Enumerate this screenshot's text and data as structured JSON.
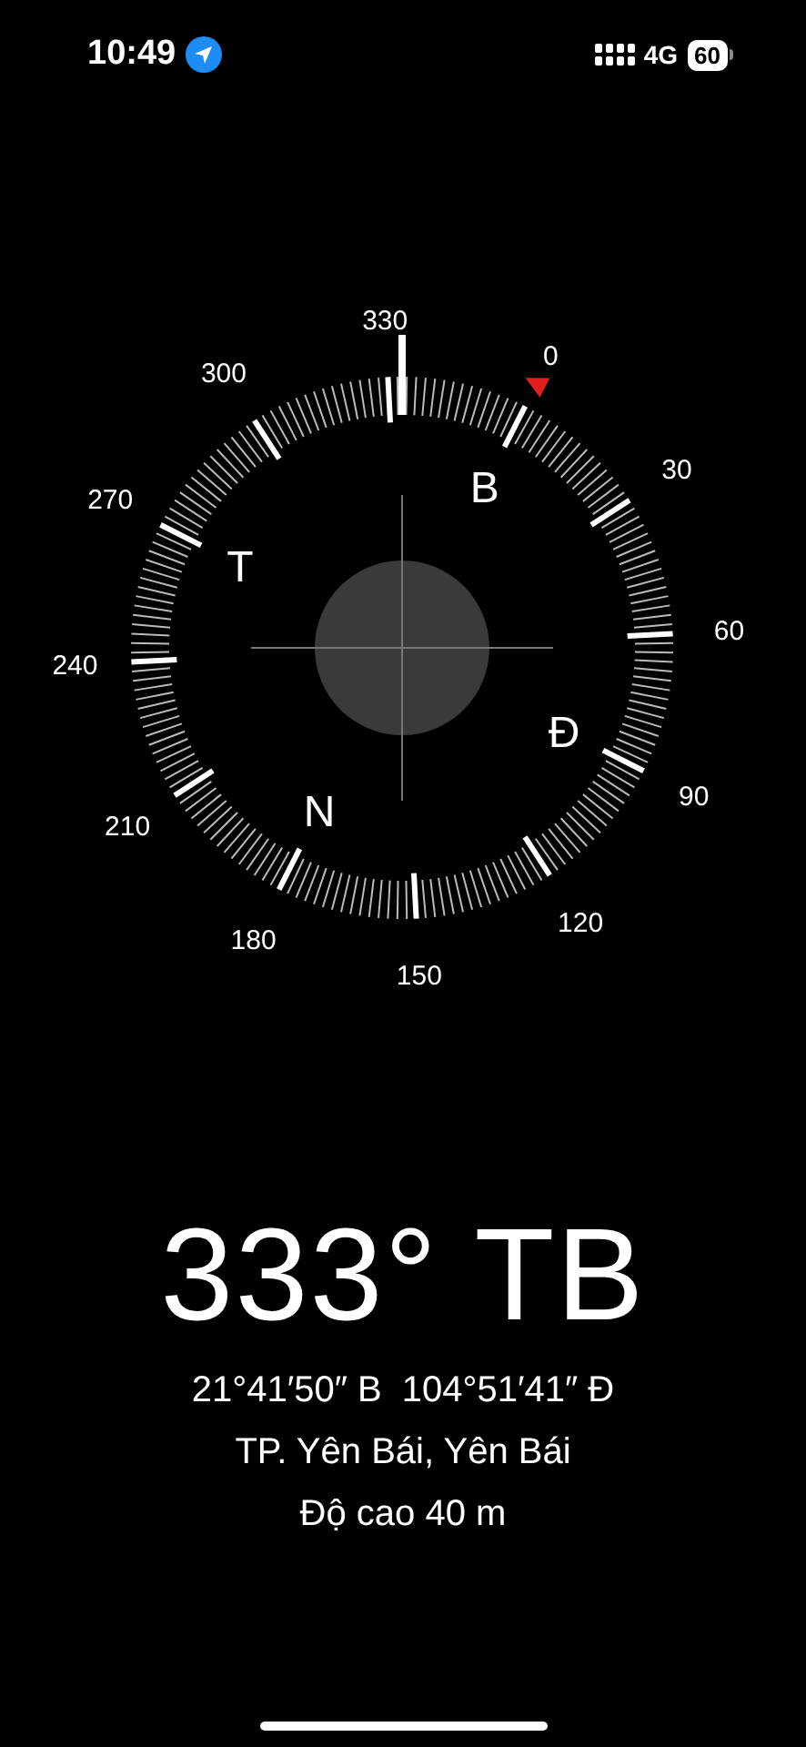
{
  "status_bar": {
    "time": "10:49",
    "network": "4G",
    "battery": "60"
  },
  "compass": {
    "degree_labels": [
      "0",
      "30",
      "60",
      "90",
      "120",
      "150",
      "180",
      "210",
      "240",
      "270",
      "300",
      "330"
    ],
    "cardinals": [
      "B",
      "Đ",
      "N",
      "T"
    ]
  },
  "heading": "333° TB",
  "coordinates": "21°41′50″ B  104°51′41″ Đ",
  "location": "TP. Yên Bái, Yên Bái",
  "elevation": "Độ cao 40 m"
}
